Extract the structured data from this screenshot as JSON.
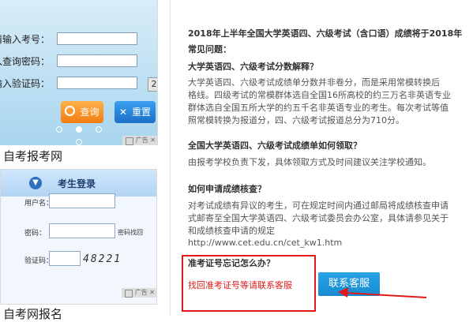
{
  "ad_top": {
    "fields": [
      {
        "label": "请输入考号："
      },
      {
        "label": "输入查询密码："
      },
      {
        "label": "请输入验证码："
      }
    ],
    "captcha_char": "2",
    "query_button": "查询",
    "reset_button": "重置",
    "ad_badge": "广告",
    "caption": "自考报考网"
  },
  "ad_bottom": {
    "title": "考生登录",
    "username_label": "用户名：",
    "password_label": "密码：",
    "retrieve_password": "密码找回",
    "captcha_label": "验证码：",
    "captcha_code": "48221",
    "ad_badge": "广告",
    "caption": "自考网报名"
  },
  "article": {
    "line_intro": "2018年上半年全国大学英语四、六级考试（含口语）成绩将于2018年",
    "faq_title": "常见问题：",
    "q1_title": "大学英语四、六级考试分数解释？",
    "q1_lines": [
      "大学英语四、六级考试成绩单分数并非卷分，而是采用常模转换后",
      "格线。四级考试的常模群体选自全国16所高校的约三万名非英语专业",
      "群体选自全国五所大学的约五千名非英语专业的考生。每次考试等值",
      "照常模转换为报道分，四、六级考试报道总分为710分。"
    ],
    "q2_title": "全国大学英语四、六级考试成绩单如何领取？",
    "q2_line": "由报考学校负责下发，具体领取方式及时间建议关注学校通知。",
    "q3_title": "如何申请成绩核查？",
    "q3_lines": [
      "对考试成绩有异议的考生，可在规定时间内通过邮局将成绩核查申请",
      "式邮寄至全国大学英语四、六级考试委员会办公室，具体请参见关于",
      "和成绩核查申请的规定"
    ],
    "q3_link": "http://www.cet.edu.cn/cet_kw1.htm",
    "q4_title": "准考证号忘记怎么办？",
    "q4_answer": "找回准考证号等请联系客服",
    "contact_button": "联系客服"
  },
  "colors": {
    "highlight_red": "#e01a1a",
    "contact_blue": "#1e98db",
    "query_orange": "#f5921e",
    "reset_blue": "#2a86dc"
  }
}
